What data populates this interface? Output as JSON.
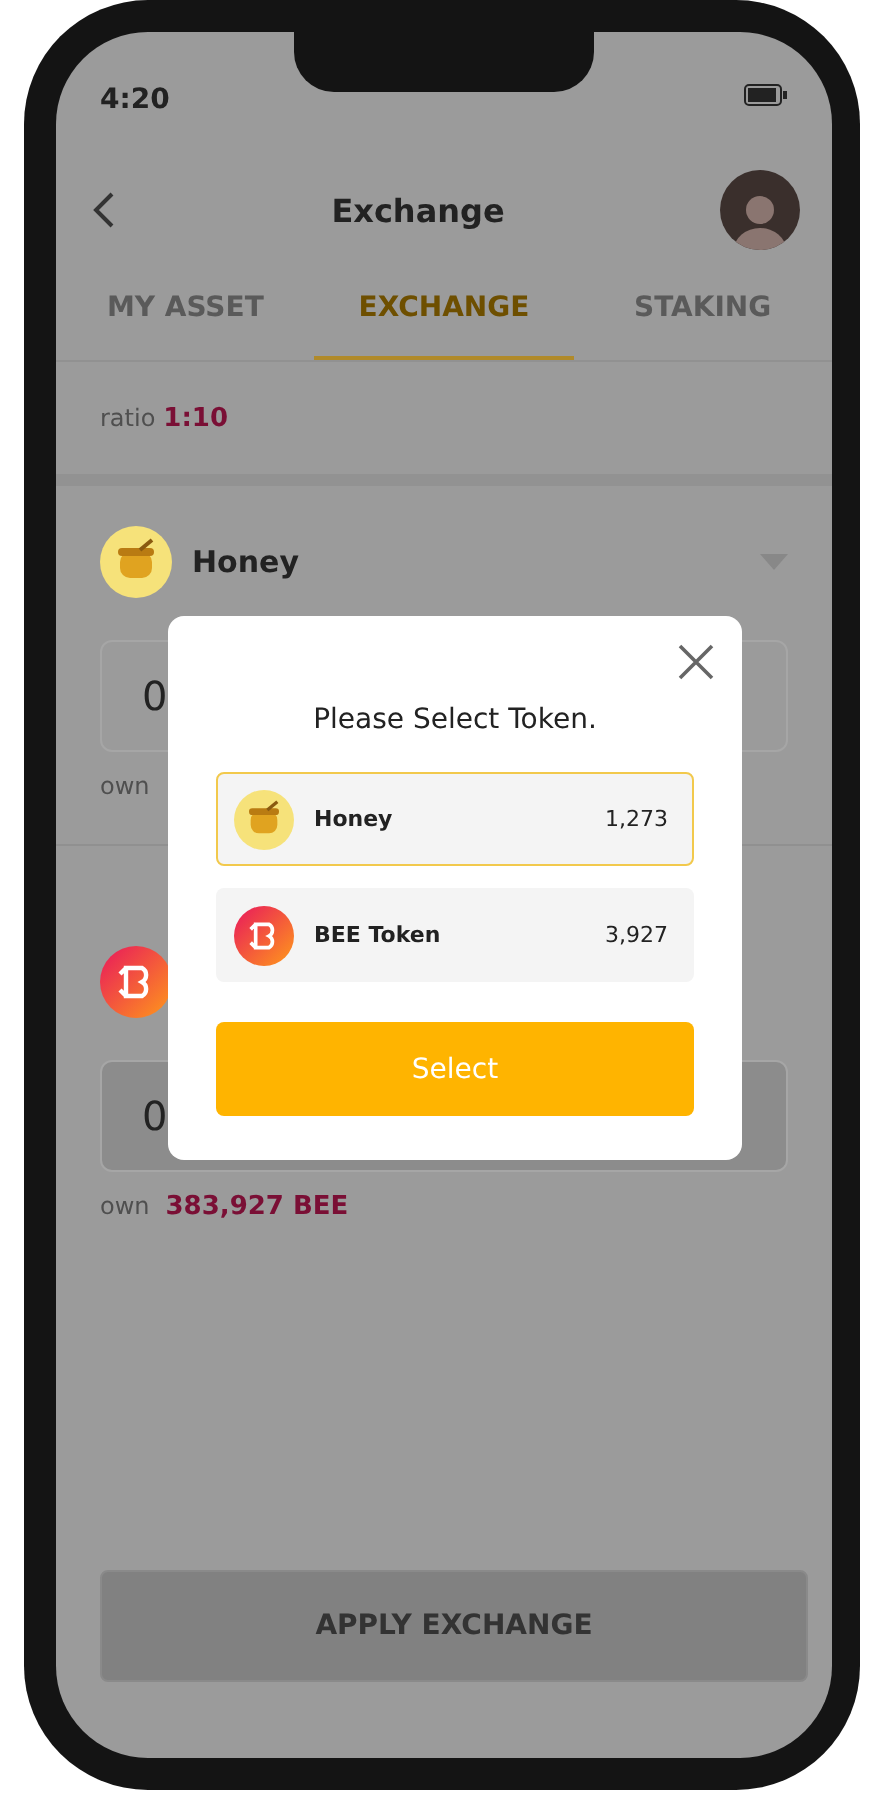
{
  "status_bar": {
    "time": "4:20"
  },
  "header": {
    "title": "Exchange"
  },
  "tabs": [
    {
      "label": "MY ASSET",
      "selected": false
    },
    {
      "label": "EXCHANGE",
      "selected": true
    },
    {
      "label": "STAKING",
      "selected": false
    }
  ],
  "ratio": {
    "label": "ratio",
    "value": "1:10"
  },
  "from": {
    "token": "Honey",
    "kind": "honey",
    "amount": "0",
    "own_label": "own"
  },
  "to": {
    "kind": "bee",
    "amount": "0",
    "own_label": "own",
    "own_value": "383,927 BEE"
  },
  "apply_button": {
    "label": "APPLY EXCHANGE",
    "disabled": true
  },
  "modal": {
    "title": "Please Select Token.",
    "options": [
      {
        "kind": "honey",
        "name": "Honey",
        "balance": "1,273",
        "selected": true
      },
      {
        "kind": "bee",
        "name": "BEE Token",
        "balance": "3,927",
        "selected": false
      }
    ],
    "confirm": "Select"
  }
}
